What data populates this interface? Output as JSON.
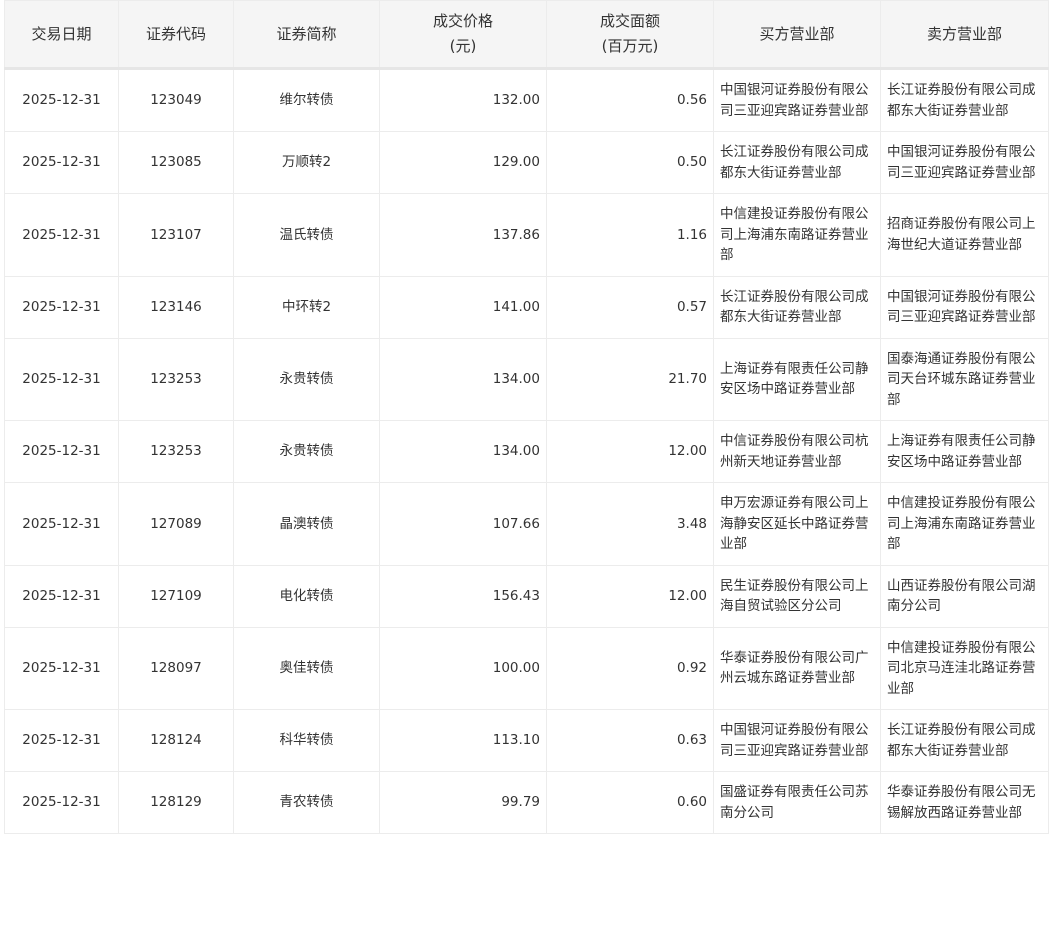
{
  "headers": [
    "交易日期",
    "证券代码",
    "证券简称",
    "成交价格\n(元)",
    "成交面额\n(百万元)",
    "买方营业部",
    "卖方营业部"
  ],
  "headers_split": [
    [
      "交易日期"
    ],
    [
      "证券代码"
    ],
    [
      "证券简称"
    ],
    [
      "成交价格",
      "(元)"
    ],
    [
      "成交面额",
      "(百万元)"
    ],
    [
      "买方营业部"
    ],
    [
      "卖方营业部"
    ]
  ],
  "rows": [
    {
      "date": "2025-12-31",
      "code": "123049",
      "name": "维尔转债",
      "price": "132.00",
      "amount": "0.56",
      "buyer": "中国银河证券股份有限公司三亚迎宾路证券营业部",
      "seller": "长江证券股份有限公司成都东大街证券营业部"
    },
    {
      "date": "2025-12-31",
      "code": "123085",
      "name": "万顺转2",
      "price": "129.00",
      "amount": "0.50",
      "buyer": "长江证券股份有限公司成都东大街证券营业部",
      "seller": "中国银河证券股份有限公司三亚迎宾路证券营业部"
    },
    {
      "date": "2025-12-31",
      "code": "123107",
      "name": "温氏转债",
      "price": "137.86",
      "amount": "1.16",
      "buyer": "中信建投证券股份有限公司上海浦东南路证券营业部",
      "seller": "招商证券股份有限公司上海世纪大道证券营业部"
    },
    {
      "date": "2025-12-31",
      "code": "123146",
      "name": "中环转2",
      "price": "141.00",
      "amount": "0.57",
      "buyer": "长江证券股份有限公司成都东大街证券营业部",
      "seller": "中国银河证券股份有限公司三亚迎宾路证券营业部"
    },
    {
      "date": "2025-12-31",
      "code": "123253",
      "name": "永贵转债",
      "price": "134.00",
      "amount": "21.70",
      "buyer": "上海证券有限责任公司静安区场中路证券营业部",
      "seller": "国泰海通证券股份有限公司天台环城东路证券营业部"
    },
    {
      "date": "2025-12-31",
      "code": "123253",
      "name": "永贵转债",
      "price": "134.00",
      "amount": "12.00",
      "buyer": "中信证券股份有限公司杭州新天地证券营业部",
      "seller": "上海证券有限责任公司静安区场中路证券营业部"
    },
    {
      "date": "2025-12-31",
      "code": "127089",
      "name": "晶澳转债",
      "price": "107.66",
      "amount": "3.48",
      "buyer": "申万宏源证券有限公司上海静安区延长中路证券营业部",
      "seller": "中信建投证券股份有限公司上海浦东南路证券营业部"
    },
    {
      "date": "2025-12-31",
      "code": "127109",
      "name": "电化转债",
      "price": "156.43",
      "amount": "12.00",
      "buyer": "民生证券股份有限公司上海自贸试验区分公司",
      "seller": "山西证券股份有限公司湖南分公司"
    },
    {
      "date": "2025-12-31",
      "code": "128097",
      "name": "奥佳转债",
      "price": "100.00",
      "amount": "0.92",
      "buyer": "华泰证券股份有限公司广州云城东路证券营业部",
      "seller": "中信建投证券股份有限公司北京马连洼北路证券营业部"
    },
    {
      "date": "2025-12-31",
      "code": "128124",
      "name": "科华转债",
      "price": "113.10",
      "amount": "0.63",
      "buyer": "中国银河证券股份有限公司三亚迎宾路证券营业部",
      "seller": "长江证券股份有限公司成都东大街证券营业部"
    },
    {
      "date": "2025-12-31",
      "code": "128129",
      "name": "青农转债",
      "price": "99.79",
      "amount": "0.60",
      "buyer": "国盛证券有限责任公司苏南分公司",
      "seller": "华泰证券股份有限公司无锡解放西路证券营业部"
    }
  ]
}
